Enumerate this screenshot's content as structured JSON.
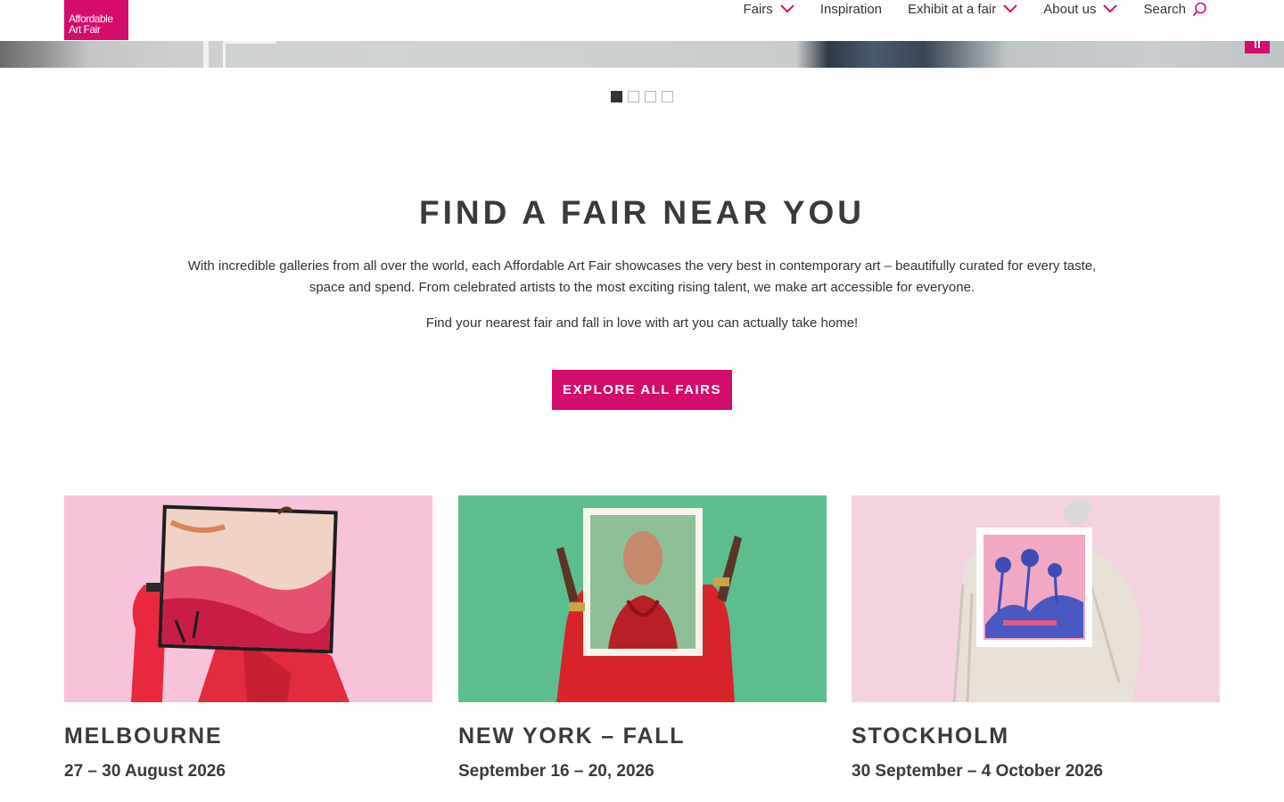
{
  "brand": {
    "logo_line1": "Affordable",
    "logo_line2": "Art Fair",
    "accent": "#d40d6c"
  },
  "nav": {
    "items": [
      {
        "label": "Fairs",
        "dropdown": true
      },
      {
        "label": "Inspiration",
        "dropdown": false
      },
      {
        "label": "Exhibit at a fair",
        "dropdown": true
      },
      {
        "label": "About us",
        "dropdown": true
      }
    ],
    "search_label": "Search",
    "search_icon": "search-icon",
    "dropdown_icon": "chevron-down-icon"
  },
  "carousel": {
    "slides": 4,
    "active_slide": 1,
    "pause_icon": "pause-icon"
  },
  "intro": {
    "title": "FIND A FAIR NEAR YOU",
    "paragraph1": "With incredible galleries from all over the world, each Affordable Art Fair showcases the very best in contemporary art – beautifully curated for every taste, space and spend. From celebrated artists to the most exciting rising talent, we make art accessible for everyone.",
    "paragraph2": "Find your nearest fair and fall in love with art you can actually take home!",
    "cta_label": "EXPLORE ALL FAIRS"
  },
  "fairs": [
    {
      "name": "MELBOURNE",
      "dates": "27 – 30 August 2026",
      "bg": "#f6c3da"
    },
    {
      "name": "NEW YORK – FALL",
      "dates": "September 16 – 20, 2026",
      "bg": "#5ebd8f"
    },
    {
      "name": "STOCKHOLM",
      "dates": "30 September – 4 October 2026",
      "bg": "#f4d3e1"
    }
  ]
}
